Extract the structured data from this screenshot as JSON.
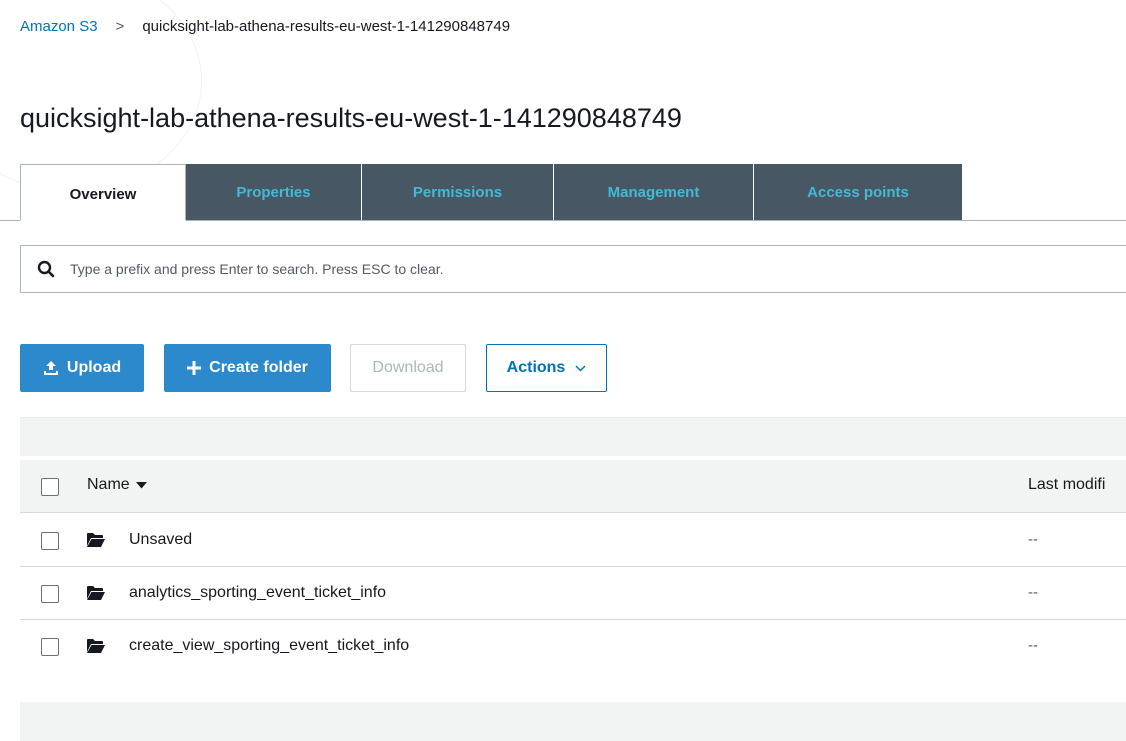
{
  "breadcrumb": {
    "root": "Amazon S3",
    "separator": ">",
    "current": "quicksight-lab-athena-results-eu-west-1-141290848749"
  },
  "page": {
    "title": "quicksight-lab-athena-results-eu-west-1-141290848749"
  },
  "tabs": [
    {
      "label": "Overview",
      "active": true
    },
    {
      "label": "Properties",
      "active": false
    },
    {
      "label": "Permissions",
      "active": false
    },
    {
      "label": "Management",
      "active": false
    },
    {
      "label": "Access points",
      "active": false
    }
  ],
  "search": {
    "placeholder": "Type a prefix and press Enter to search. Press ESC to clear.",
    "value": "",
    "icon": "search-icon"
  },
  "toolbar": {
    "upload_label": "Upload",
    "upload_icon": "upload-icon",
    "create_folder_label": "Create folder",
    "create_folder_icon": "plus-icon",
    "download_label": "Download",
    "actions_label": "Actions",
    "actions_icon": "chevron-down-icon"
  },
  "table": {
    "columns": {
      "name": "Name",
      "last_modified": "Last modifi"
    },
    "rows": [
      {
        "name": "Unsaved",
        "last_modified": "--",
        "type": "folder"
      },
      {
        "name": "analytics_sporting_event_ticket_info",
        "last_modified": "--",
        "type": "folder"
      },
      {
        "name": "create_view_sporting_event_ticket_info",
        "last_modified": "--",
        "type": "folder"
      }
    ]
  },
  "colors": {
    "link": "#0073bb",
    "primary_button": "#2b89cc",
    "tab_inactive_bg": "#485764",
    "tab_inactive_text": "#44b9d6"
  }
}
